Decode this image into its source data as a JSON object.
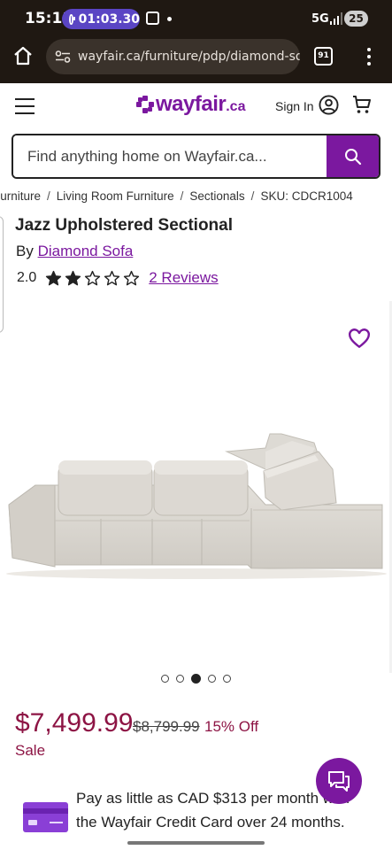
{
  "status_bar": {
    "time": "15:11",
    "timer": "01:03.30",
    "network": "5G",
    "battery": "25"
  },
  "browser": {
    "url": "wayfair.ca/furniture/pdp/diamond-sofa",
    "tab_count": "91"
  },
  "header": {
    "logo_text": "wayfair",
    "logo_tld": ".ca",
    "sign_in": "Sign In",
    "brand_color": "#7b189f"
  },
  "search": {
    "placeholder": "Find anything home on Wayfair.ca..."
  },
  "breadcrumb": {
    "items": [
      "Furniture",
      "Living Room Furniture",
      "Sectionals",
      "SKU: CDCR1004"
    ],
    "separator": "/"
  },
  "product": {
    "title": "Jazz Upholstered Sectional",
    "by_prefix": "By",
    "brand": "Diamond Sofa",
    "rating": "2.0",
    "rating_stars": 2,
    "rating_max": 5,
    "reviews_link": "2 Reviews"
  },
  "gallery": {
    "image_count": 5,
    "active_index": 2
  },
  "pricing": {
    "price": "$7,499.99",
    "was_price": "$8,799.99",
    "discount": "15% Off",
    "sale_label": "Sale",
    "price_color": "#8d1444"
  },
  "credit": {
    "text": "Pay as little as CAD $313 per month with the Wayfair Credit Card over 24 months."
  },
  "icons": {
    "home": "home-icon",
    "search": "search-icon",
    "cart": "cart-icon",
    "account": "account-icon",
    "favorite": "heart-icon",
    "chat": "chat-icon",
    "menu": "hamburger-icon"
  }
}
